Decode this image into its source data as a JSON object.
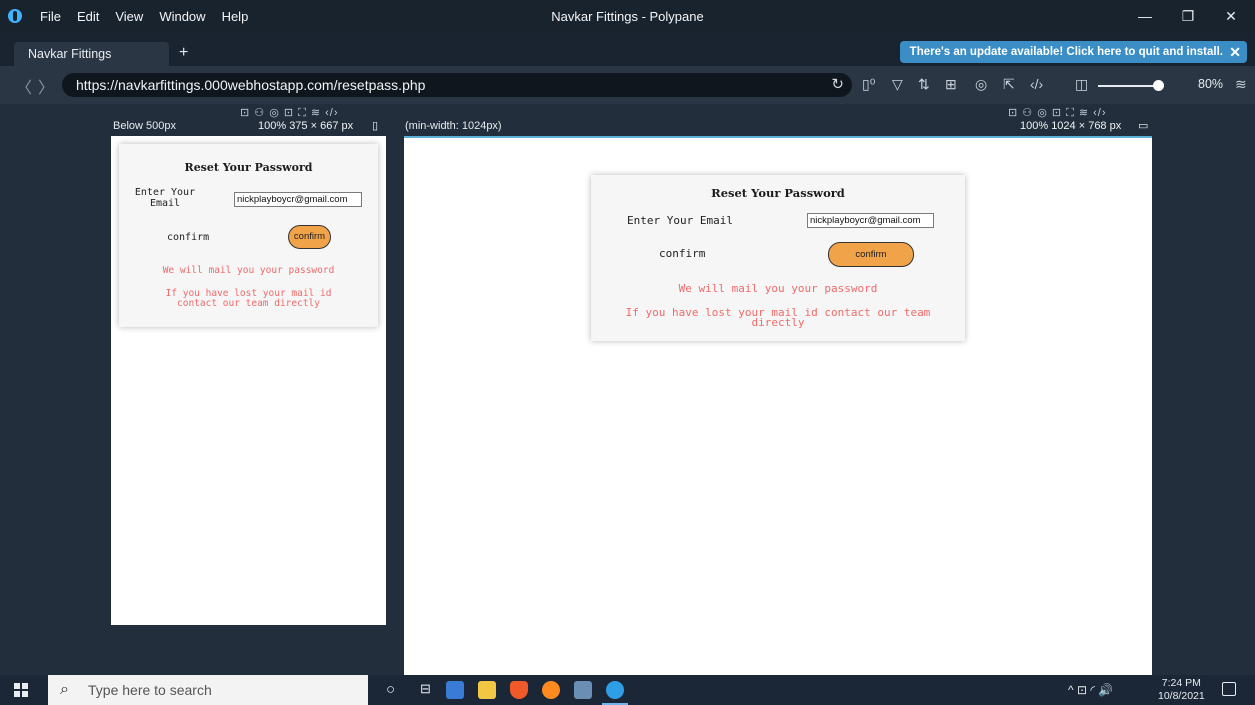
{
  "titlebar": {
    "menu": [
      "File",
      "Edit",
      "View",
      "Window",
      "Help"
    ],
    "title": "Navkar Fittings - Polypane",
    "minimize": "—",
    "restore": "❐",
    "close": "✕"
  },
  "tabs": {
    "active_tab": "Navkar Fittings",
    "add": "+",
    "update_notice": "There's an update available! Click here to quit and install.",
    "update_close": "✕"
  },
  "address_bar": {
    "back": "〈",
    "forward": "〉",
    "url": "https://navkarfittings.000webhostapp.com/resetpass.php",
    "zoom": "80%"
  },
  "panes": {
    "small": {
      "label": "Below 500px",
      "tools": "⊡ ⚇ ◎ ⊡ ⛶ ≋ ‹/›",
      "dims": "100%  375 × 667 px"
    },
    "large": {
      "label": "(min-width: 1024px)",
      "tools": "⊡ ⚇ ◎ ⊡ ⛶ ≋ ‹/›",
      "dims": "100%  1024 × 768 px"
    }
  },
  "reset_form": {
    "title": "Reset Your Password",
    "email_label": "Enter Your Email",
    "email_label_line1": "Enter Your",
    "email_label_line2": "Email",
    "email_value": "nickplayboycr@gmail.com",
    "confirm_label": "confirm",
    "confirm_button": "confirm",
    "mail_message": "We will mail you your password",
    "lost_message": "If you have lost your mail id contact our team directly",
    "lost_message_small_1": "If you have lost your mail id",
    "lost_message_small_2": "contact our team directly",
    "lost_message_large_1": "If you have lost your mail id contact our team",
    "lost_message_large_2": "directly"
  },
  "taskbar": {
    "search_placeholder": "Type here to search",
    "time": "7:24 PM",
    "date": "10/8/2021",
    "tray": "^  ⊡  ◜  🔊"
  },
  "colors": {
    "accent": "#3b8ec5",
    "button": "#f0a348",
    "error_text": "#f06a6a"
  }
}
